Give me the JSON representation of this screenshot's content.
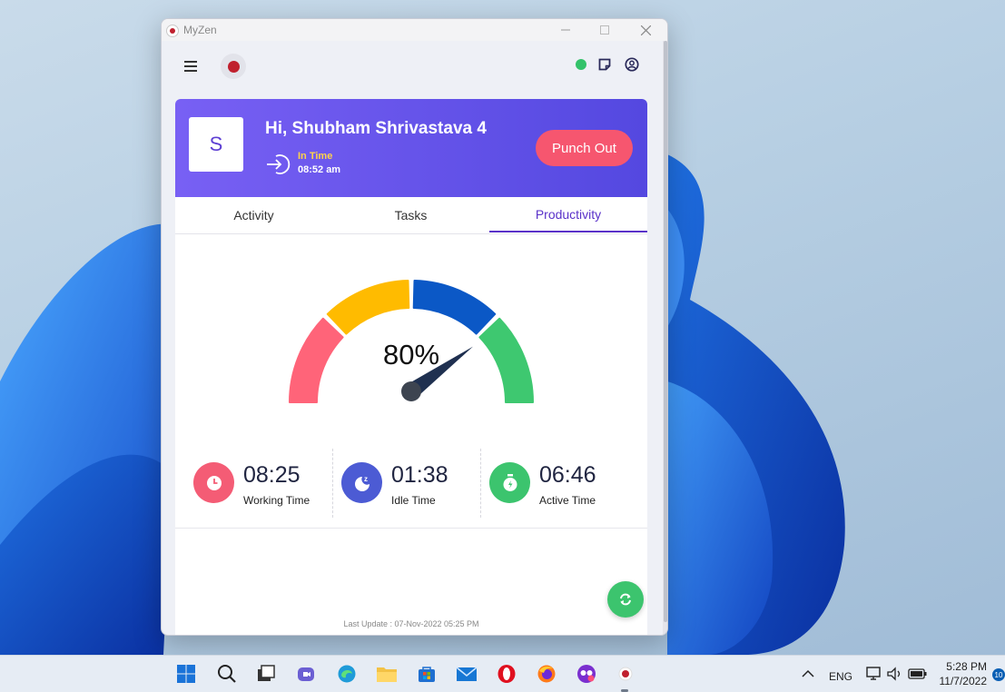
{
  "window": {
    "title": "MyZen"
  },
  "header": {
    "avatar_letter": "S",
    "greeting": "Hi, Shubham Shrivastava 4",
    "in_time_label": "In Time",
    "in_time_value": "08:52 am",
    "punch_button": "Punch Out"
  },
  "tabs": [
    {
      "label": "Activity",
      "active": false
    },
    {
      "label": "Tasks",
      "active": false
    },
    {
      "label": "Productivity",
      "active": true
    }
  ],
  "gauge": {
    "percent_label": "80%",
    "value": 80,
    "segment_colors": [
      "#ff6479",
      "#ffbb00",
      "#0b58c6",
      "#3ec870"
    ]
  },
  "stats": [
    {
      "value": "08:25",
      "label": "Working Time",
      "icon": "clock-icon",
      "color": "#f45c75"
    },
    {
      "value": "01:38",
      "label": "Idle Time",
      "icon": "sleep-icon",
      "color": "#4c5bd4"
    },
    {
      "value": "06:46",
      "label": "Active Time",
      "icon": "stopwatch-icon",
      "color": "#3cc46e"
    }
  ],
  "footer": {
    "last_update": "Last Update : 07-Nov-2022 05:25 PM"
  },
  "status": {
    "online_color": "#33c26a"
  },
  "taskbar": {
    "language": "ENG",
    "time": "5:28 PM",
    "date": "11/7/2022",
    "notification_count": "10"
  }
}
